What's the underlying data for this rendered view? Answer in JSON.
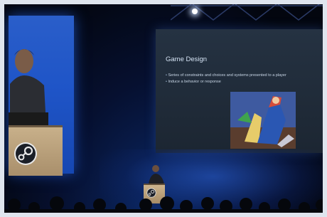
{
  "slide": {
    "title": "Game Design",
    "bullets": [
      "Series of constraints and choices and systems presented to a player",
      "Induce a behavior or response"
    ]
  },
  "icons": {
    "left_screen_logo": "steam-logo-icon",
    "podium_logo": "steam-logo-icon"
  },
  "colors": {
    "stage_blue": "#1f55c8",
    "slide_bg": "#253242",
    "slide_text": "#d5e4f5"
  }
}
